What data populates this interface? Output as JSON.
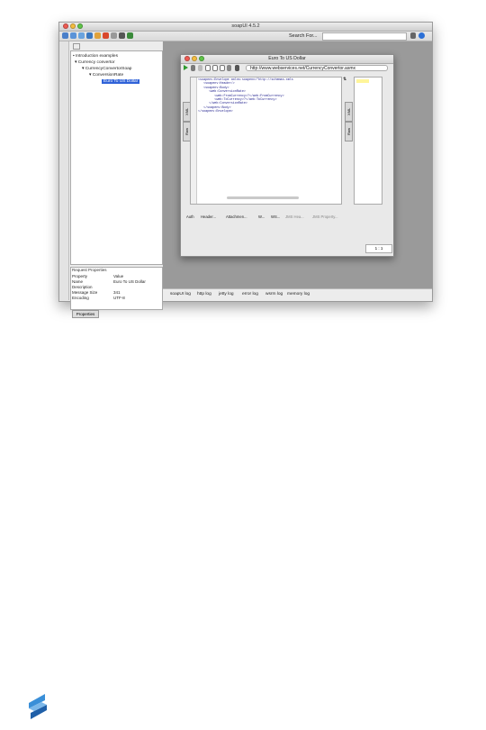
{
  "window": {
    "title": "soapUI 4.5.2"
  },
  "toolbar": {
    "search_label": "Search For...",
    "search_value": ""
  },
  "navigator": {
    "tree": [
      {
        "label": "Introduction examples",
        "level": 0
      },
      {
        "label": "Currency convertor",
        "level": 1
      },
      {
        "label": "CurrencyConvertorSoap",
        "level": 2
      },
      {
        "label": "ConversionRate",
        "level": 3
      },
      {
        "label": "Euro To US Dollar",
        "level": 4,
        "selected": true
      }
    ]
  },
  "properties": {
    "title": "Request Properties",
    "headers": [
      "Property",
      "Value"
    ],
    "rows": [
      {
        "name": "Name",
        "value": "Euro To US Dollar"
      },
      {
        "name": "Description",
        "value": ""
      },
      {
        "name": "Message Size",
        "value": "341"
      },
      {
        "name": "Encoding",
        "value": "UTF-8"
      }
    ],
    "tab_label": "Properties"
  },
  "request": {
    "title": "Euro To US Dollar",
    "endpoint": "http://www.webservices.net/CurrencyConvertor.asmx",
    "xml": "<soapenv:Envelope xmlns:soapenv=\"http://schemas.xmls\n   <soapenv:Header/>\n   <soapenv:Body>\n      <web:ConversionRate>\n         <web:FromCurrency>?</web:FromCurrency>\n         <web:ToCurrency>?</web:ToCurrency>\n      </web:ConversionRate>\n   </soapenv:Body>\n</soapenv:Envelope>",
    "side_tabs": {
      "xml": "XML",
      "raw": "Raw"
    },
    "bottom_tabs": [
      "Auth",
      "Header...",
      "Attachmen...",
      "W...",
      "WS...",
      "JMS Hea...",
      "JMS Property..."
    ],
    "cursor_pos": "1 : 1"
  },
  "logs": [
    "soapUI log",
    "http log",
    "jetty log",
    "error log",
    "wsrm log",
    "memory log"
  ]
}
